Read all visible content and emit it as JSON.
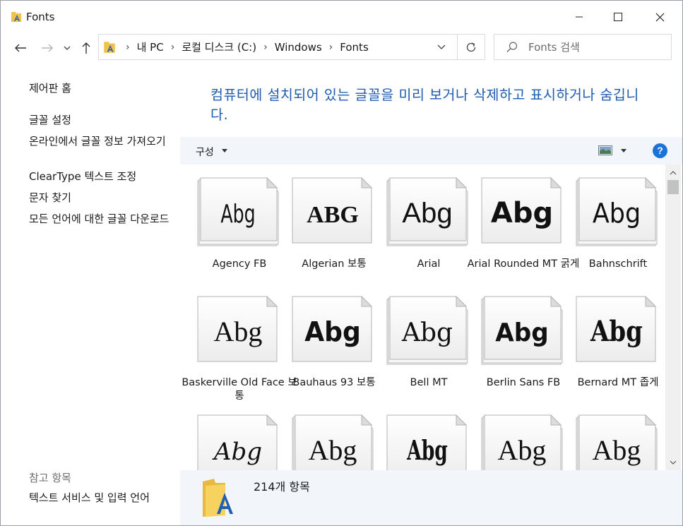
{
  "window": {
    "title": "Fonts",
    "colors": {
      "accent": "#1e5bb0",
      "help": "#1a73d9",
      "toolbar": "#f2f5f9"
    }
  },
  "nav": {
    "back_icon": "arrow-left-icon",
    "forward_icon": "arrow-right-icon",
    "recent_icon": "chevron-down-icon",
    "up_icon": "arrow-up-icon"
  },
  "address": {
    "breadcrumbs": [
      "내 PC",
      "로컬 디스크 (C:)",
      "Windows",
      "Fonts"
    ]
  },
  "search": {
    "placeholder": "Fonts 검색"
  },
  "left_pane": {
    "links": [
      "제어판 홈",
      "글꼴 설정",
      "온라인에서 글꼴 정보 가져오기",
      "ClearType 텍스트 조정",
      "문자 찾기",
      "모든 언어에 대한 글꼴 다운로드"
    ],
    "see_also_label": "참고 항목",
    "see_also_links": [
      "텍스트 서비스 및 입력 언어"
    ]
  },
  "main": {
    "header": "컴퓨터에 설치되어 있는 글꼴을 미리 보거나 삭제하고 표시하거나 숨깁니다.",
    "toolbar": {
      "organize_label": "구성",
      "help_label": "?"
    },
    "fonts": [
      {
        "name": "Agency FB",
        "preview": "Abg",
        "stacked": true
      },
      {
        "name": "Algerian 보통",
        "preview": "ABG",
        "stacked": false
      },
      {
        "name": "Arial",
        "preview": "Abg",
        "stacked": true
      },
      {
        "name": "Arial Rounded MT 굵게",
        "preview": "Abg",
        "stacked": false
      },
      {
        "name": "Bahnschrift",
        "preview": "Abg",
        "stacked": true
      },
      {
        "name": "Baskerville Old Face 보통",
        "preview": "Abg",
        "stacked": false
      },
      {
        "name": "Bauhaus 93 보통",
        "preview": "Abg",
        "stacked": false
      },
      {
        "name": "Bell MT",
        "preview": "Abg",
        "stacked": true
      },
      {
        "name": "Berlin Sans FB",
        "preview": "Abg",
        "stacked": true
      },
      {
        "name": "Bernard MT 좁게",
        "preview": "Abg",
        "stacked": false
      },
      {
        "name": "",
        "preview": "Abg",
        "stacked": false
      },
      {
        "name": "",
        "preview": "Abg",
        "stacked": true
      },
      {
        "name": "",
        "preview": "Abg",
        "stacked": false
      },
      {
        "name": "",
        "preview": "Abg",
        "stacked": true
      },
      {
        "name": "",
        "preview": "Abg",
        "stacked": true
      }
    ]
  },
  "details": {
    "count_text": "214개 항목"
  }
}
